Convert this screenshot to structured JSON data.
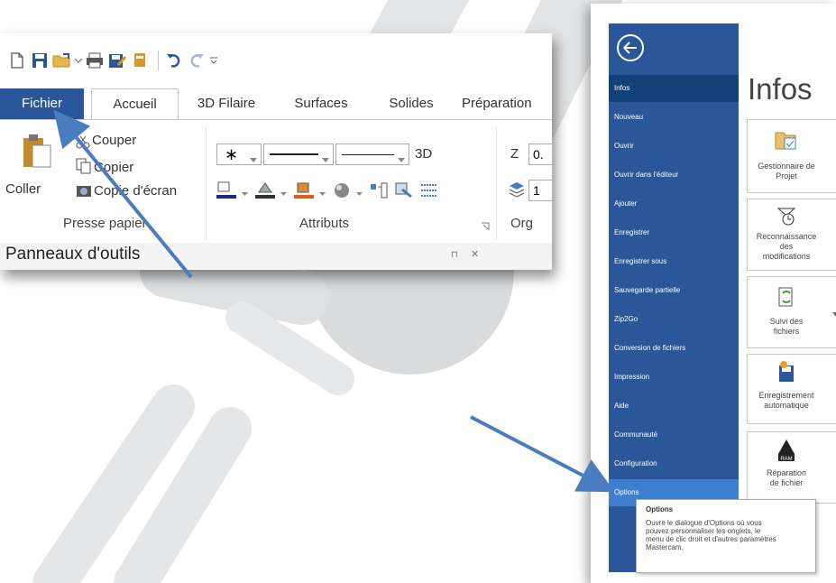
{
  "ribbon": {
    "tabs": [
      "Fichier",
      "Accueil",
      "3D Filaire",
      "Surfaces",
      "Solides",
      "Préparation"
    ],
    "clipboard": {
      "paste_label": "Coller",
      "cut_label": "Couper",
      "copy_label": "Copier",
      "screenshot_label": "Copie d'écran",
      "group_label": "Presse papier"
    },
    "attributes": {
      "three_d_label": "3D",
      "group_label": "Attributs"
    },
    "org": {
      "z_label": "Z",
      "z_value": "0.",
      "level_value": "1",
      "group_label": "Org"
    },
    "panel_title": "Panneaux d'outils"
  },
  "backstage": {
    "title": "Infos",
    "nav": [
      "Infos",
      "Nouveau",
      "Ouvrir",
      "Ouvrir dans l'éditeur",
      "Ajouter",
      "Enregistrer",
      "Enregistrer sous",
      "Sauvegarde partielle",
      "Zip2Go",
      "Conversion de fichiers",
      "Impression",
      "Aide",
      "Communauté",
      "Configuration",
      "Options"
    ],
    "tiles": [
      {
        "line1": "Gestionnaire de",
        "line2": "Projet",
        "line3": ""
      },
      {
        "line1": "Reconnaissance",
        "line2": "des",
        "line3": "modifications"
      },
      {
        "line1": "Suivi des",
        "line2": "fichiers",
        "line3": ""
      },
      {
        "line1": "Enregistrement",
        "line2": "automatique",
        "line3": ""
      },
      {
        "line1": "Réparation",
        "line2": "de fichier",
        "line3": ""
      }
    ],
    "ram_label": "RAM",
    "tooltip": {
      "title": "Options",
      "line1": "Ouvre le dialogue d'Options où vous",
      "line2": "pouvez personnaliser les onglets, le",
      "line3": "menu de clic droit et d'autres paramètres",
      "line4": "Mastercam."
    }
  },
  "colors": {
    "accent": "#2b579a",
    "nav_selected": "#124078",
    "nav_hover": "#3f7fd0",
    "arrow": "#4a7cc0",
    "decor": "#dfe1e3"
  }
}
